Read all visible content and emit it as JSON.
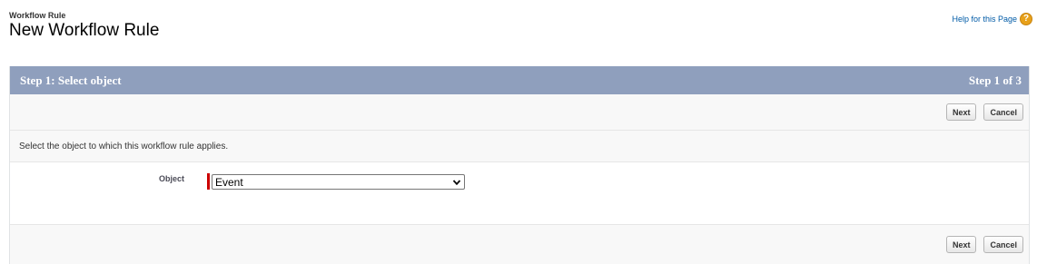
{
  "header": {
    "breadcrumb": "Workflow Rule",
    "title": "New Workflow Rule",
    "help_link": "Help for this Page",
    "help_icon": "question-mark-icon"
  },
  "step": {
    "title": "Step 1: Select object",
    "progress": "Step 1 of 3"
  },
  "buttons": {
    "next": "Next",
    "cancel": "Cancel"
  },
  "instructions": "Select the object to which this workflow rule applies.",
  "form": {
    "object_label": "Object",
    "object_value": "Event"
  },
  "colors": {
    "step_bar": "#8f9fbd",
    "required": "#cc0000",
    "help_icon": "#e8a11a",
    "link": "#015ba7"
  }
}
